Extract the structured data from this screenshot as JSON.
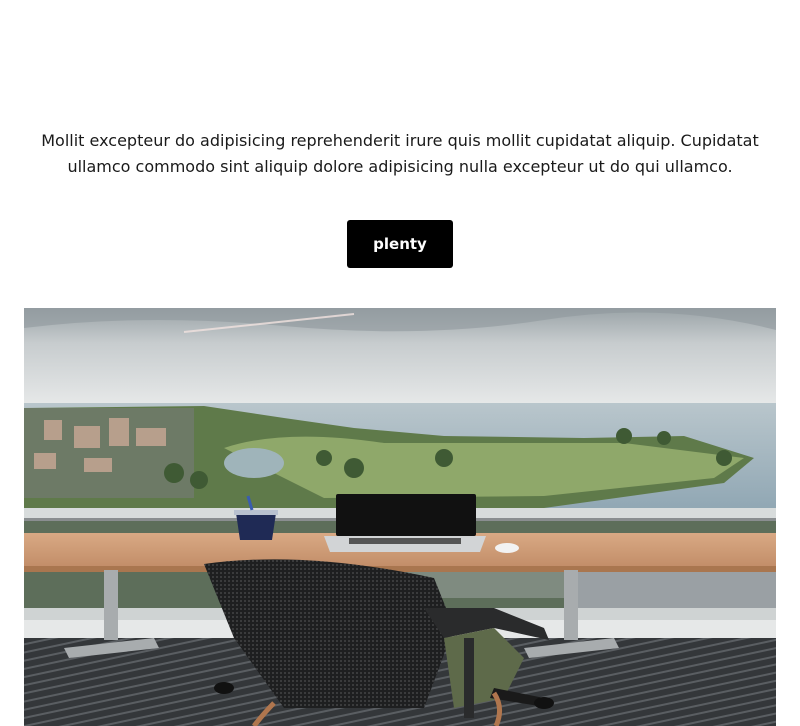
{
  "intro": {
    "text": "Mollit excepteur do adipisicing reprehenderit irure quis mollit cupidatat aliquip. Cupidatat ullamco commodo sint aliquip dolore adipisicing nulla excepteur ut do qui ullamco."
  },
  "cta": {
    "label": "plenty"
  },
  "colors": {
    "button_bg": "#000000",
    "button_text": "#ffffff",
    "body_text": "#1a1a1a"
  }
}
